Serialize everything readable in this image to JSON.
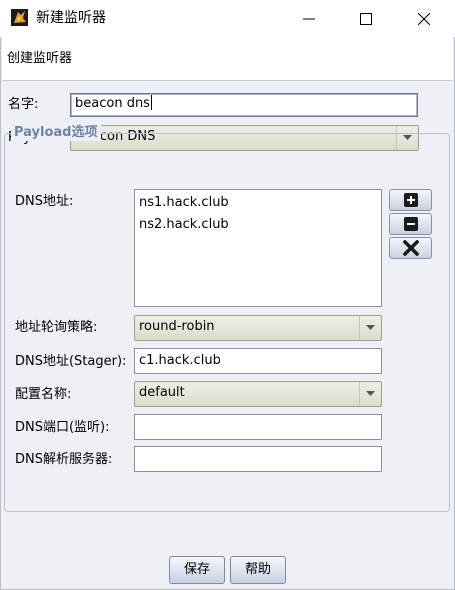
{
  "window": {
    "title": "新建监听器",
    "header": "创建监听器",
    "app_icon": "app-logo-icon",
    "controls": [
      "minimize-icon",
      "maximize-icon",
      "close-icon"
    ]
  },
  "form": {
    "name_label": "名字:",
    "name_value": "beacon dns",
    "payload_label": "Payload:",
    "payload_value": "Beacon DNS"
  },
  "options": {
    "legend": "Payload选项",
    "dns_hosts_label": "DNS地址:",
    "dns_hosts": [
      "ns1.hack.club",
      "ns2.hack.club"
    ],
    "list_buttons": [
      "add-icon",
      "remove-icon",
      "clear-icon"
    ],
    "rotation_label": "地址轮询策略:",
    "rotation_value": "round-robin",
    "stager_label": "DNS地址(Stager):",
    "stager_value": "c1.hack.club",
    "profile_label": "配置名称:",
    "profile_value": "default",
    "port_label": "DNS端口(监听):",
    "port_value": "",
    "resolver_label": "DNS解析服务器:",
    "resolver_value": ""
  },
  "buttons": {
    "save": "保存",
    "help": "帮助"
  },
  "colors": {
    "body_bg": "#eef0f6",
    "combo_bg": "#e4e4d6",
    "legend": "#6d84a6"
  }
}
